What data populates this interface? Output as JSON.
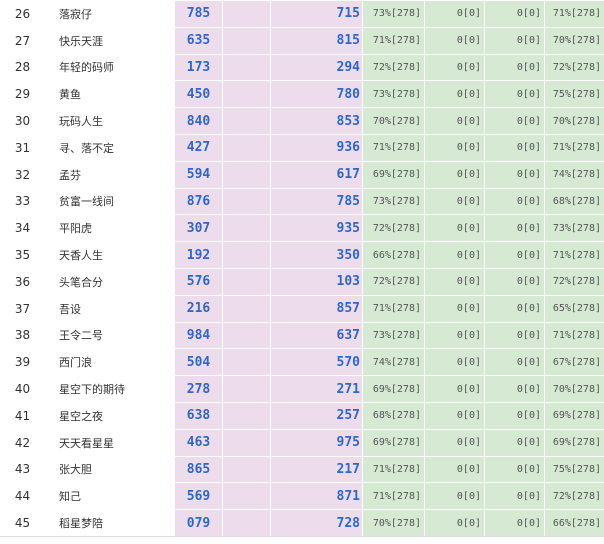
{
  "rows": [
    {
      "rank": "26",
      "name": "落寂仔",
      "v1": "785",
      "v2": "715",
      "p1": "73%[278]",
      "p2": "0[0]",
      "p3": "0[0]",
      "p4": "71%[278]"
    },
    {
      "rank": "27",
      "name": "快乐天涯",
      "v1": "635",
      "v2": "815",
      "p1": "71%[278]",
      "p2": "0[0]",
      "p3": "0[0]",
      "p4": "70%[278]"
    },
    {
      "rank": "28",
      "name": "年轻的码师",
      "v1": "173",
      "v2": "294",
      "p1": "72%[278]",
      "p2": "0[0]",
      "p3": "0[0]",
      "p4": "72%[278]"
    },
    {
      "rank": "29",
      "name": "黄鱼",
      "v1": "450",
      "v2": "780",
      "p1": "73%[278]",
      "p2": "0[0]",
      "p3": "0[0]",
      "p4": "75%[278]"
    },
    {
      "rank": "30",
      "name": "玩码人生",
      "v1": "840",
      "v2": "853",
      "p1": "70%[278]",
      "p2": "0[0]",
      "p3": "0[0]",
      "p4": "70%[278]"
    },
    {
      "rank": "31",
      "name": "寻、落不定",
      "v1": "427",
      "v2": "936",
      "p1": "71%[278]",
      "p2": "0[0]",
      "p3": "0[0]",
      "p4": "71%[278]"
    },
    {
      "rank": "32",
      "name": "孟芬",
      "v1": "594",
      "v2": "617",
      "p1": "69%[278]",
      "p2": "0[0]",
      "p3": "0[0]",
      "p4": "74%[278]"
    },
    {
      "rank": "33",
      "name": "贫富一线间",
      "v1": "876",
      "v2": "785",
      "p1": "73%[278]",
      "p2": "0[0]",
      "p3": "0[0]",
      "p4": "68%[278]"
    },
    {
      "rank": "34",
      "name": "平阳虎",
      "v1": "307",
      "v2": "935",
      "p1": "72%[278]",
      "p2": "0[0]",
      "p3": "0[0]",
      "p4": "73%[278]"
    },
    {
      "rank": "35",
      "name": "天香人生",
      "v1": "192",
      "v2": "350",
      "p1": "66%[278]",
      "p2": "0[0]",
      "p3": "0[0]",
      "p4": "71%[278]"
    },
    {
      "rank": "36",
      "name": "头笔合分",
      "v1": "576",
      "v2": "103",
      "p1": "72%[278]",
      "p2": "0[0]",
      "p3": "0[0]",
      "p4": "72%[278]"
    },
    {
      "rank": "37",
      "name": "吾设",
      "v1": "216",
      "v2": "857",
      "p1": "71%[278]",
      "p2": "0[0]",
      "p3": "0[0]",
      "p4": "65%[278]"
    },
    {
      "rank": "38",
      "name": "王令二号",
      "v1": "984",
      "v2": "637",
      "p1": "73%[278]",
      "p2": "0[0]",
      "p3": "0[0]",
      "p4": "71%[278]"
    },
    {
      "rank": "39",
      "name": "西门浪",
      "v1": "504",
      "v2": "570",
      "p1": "74%[278]",
      "p2": "0[0]",
      "p3": "0[0]",
      "p4": "67%[278]"
    },
    {
      "rank": "40",
      "name": "星空下的期待",
      "v1": "278",
      "v2": "271",
      "p1": "69%[278]",
      "p2": "0[0]",
      "p3": "0[0]",
      "p4": "70%[278]"
    },
    {
      "rank": "41",
      "name": "星空之夜",
      "v1": "638",
      "v2": "257",
      "p1": "68%[278]",
      "p2": "0[0]",
      "p3": "0[0]",
      "p4": "69%[278]"
    },
    {
      "rank": "42",
      "name": "天天看星星",
      "v1": "463",
      "v2": "975",
      "p1": "69%[278]",
      "p2": "0[0]",
      "p3": "0[0]",
      "p4": "69%[278]"
    },
    {
      "rank": "43",
      "name": "张大胆",
      "v1": "865",
      "v2": "217",
      "p1": "71%[278]",
      "p2": "0[0]",
      "p3": "0[0]",
      "p4": "75%[278]"
    },
    {
      "rank": "44",
      "name": "知己",
      "v1": "569",
      "v2": "871",
      "p1": "71%[278]",
      "p2": "0[0]",
      "p3": "0[0]",
      "p4": "72%[278]"
    },
    {
      "rank": "45",
      "name": "稻星梦陪",
      "v1": "079",
      "v2": "728",
      "p1": "70%[278]",
      "p2": "0[0]",
      "p3": "0[0]",
      "p4": "66%[278]"
    }
  ]
}
